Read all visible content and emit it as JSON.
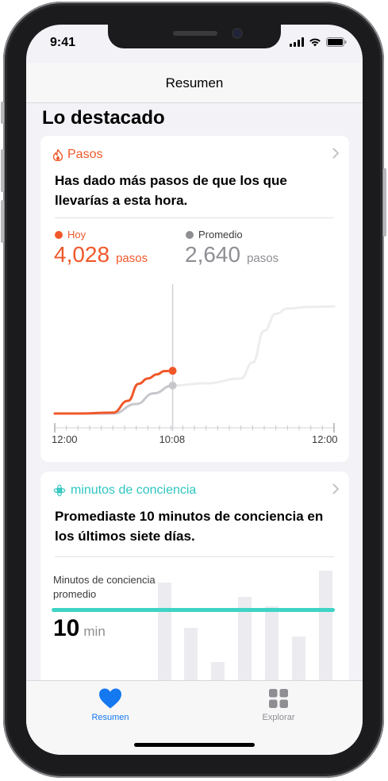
{
  "status_bar": {
    "time": "9:41"
  },
  "nav": {
    "title": "Resumen"
  },
  "section_title": "Lo destacado",
  "colors": {
    "accent_orange": "#f0582a",
    "gray": "#8e8e93",
    "mindful_teal": "#3fd3c6",
    "tab_blue": "#1478f0"
  },
  "steps_card": {
    "category_label": "Pasos",
    "category_icon": "flame-icon",
    "headline": "Has dado más pasos de que los que llevarías a esta hora.",
    "legend_today": "Hoy",
    "legend_average": "Promedio",
    "today_value": "4,028",
    "today_unit": "pasos",
    "average_value": "2,640",
    "average_unit": "pasos",
    "x_tick_labels": [
      "12:00",
      "10:08",
      "12:00"
    ]
  },
  "mindful_card": {
    "category_label": "minutos de conciencia",
    "category_icon": "mindfulness-flower-icon",
    "headline": "Promediaste 10 minutos de conciencia en los últimos siete días.",
    "metric_label": "Minutos de conciencia promedio",
    "metric_value": "10",
    "metric_unit": "min"
  },
  "tab_bar": {
    "items": [
      {
        "label": "Resumen",
        "icon": "heart-icon",
        "selected": true
      },
      {
        "label": "Explorar",
        "icon": "grid-icon",
        "selected": false
      }
    ]
  },
  "chart_data": [
    {
      "type": "line",
      "title": "",
      "xlabel": "",
      "ylabel": "",
      "x_ticks": [
        "12:00",
        "10:08",
        "12:00"
      ],
      "x_range_hours": [
        0,
        24
      ],
      "current_time_hours": 10.13,
      "series": [
        {
          "name": "Hoy",
          "color": "#f0582a",
          "x": [
            0,
            2,
            5,
            6.3,
            7.2,
            8,
            8.8,
            9.4,
            10.13
          ],
          "y": [
            0,
            0,
            80,
            1200,
            2800,
            3300,
            3700,
            4000,
            4028
          ]
        },
        {
          "name": "Promedio",
          "color": "#c7c7cc",
          "x": [
            0,
            5,
            7,
            8.5,
            10.13,
            13,
            16,
            17,
            18,
            19,
            20,
            22,
            24
          ],
          "y": [
            0,
            0,
            900,
            1900,
            2640,
            2850,
            3300,
            4800,
            7800,
            9400,
            9900,
            10050,
            10100
          ]
        }
      ],
      "ylim": [
        0,
        12500
      ],
      "grid": false
    },
    {
      "type": "bar",
      "title": "",
      "categories": [
        "1",
        "2",
        "3",
        "4",
        "5",
        "6",
        "7"
      ],
      "series": [
        {
          "name": "",
          "values": [
            13,
            7.3,
            3,
            11.2,
            10,
            6.2,
            14.5
          ]
        }
      ],
      "average_line": 10,
      "ylim": [
        0,
        15
      ]
    }
  ]
}
